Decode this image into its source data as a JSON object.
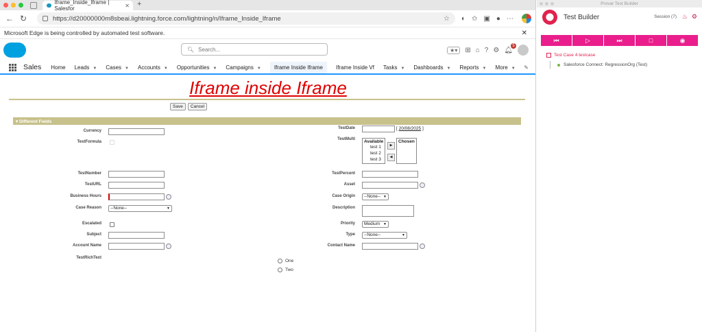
{
  "browser": {
    "tab_title": "Iframe_Inside_Iframe | Salesfor",
    "url": "https://d20000000m8sbeai.lightning.force.com/lightning/n/Iframe_Inside_Iframe",
    "infobar": "Microsoft Edge is being controlled by automated test software."
  },
  "salesforce": {
    "search_placeholder": "Search...",
    "notification_count": "5",
    "app_name": "Sales",
    "nav": [
      {
        "label": "Home",
        "chevron": false
      },
      {
        "label": "Leads",
        "chevron": true
      },
      {
        "label": "Cases",
        "chevron": true
      },
      {
        "label": "Accounts",
        "chevron": true
      },
      {
        "label": "Opportunities",
        "chevron": true
      },
      {
        "label": "Campaigns",
        "chevron": true
      },
      {
        "label": "Iframe Inside Iframe",
        "chevron": false,
        "active": true
      },
      {
        "label": "Iframe Inside Vf",
        "chevron": false
      },
      {
        "label": "Tasks",
        "chevron": true
      },
      {
        "label": "Dashboards",
        "chevron": true
      },
      {
        "label": "Reports",
        "chevron": true
      },
      {
        "label": "More",
        "chevron": true
      }
    ]
  },
  "form": {
    "page_title": "Iframe inside Iframe",
    "save_label": "Save",
    "cancel_label": "Cancel",
    "section_title": "▾ Different Fields",
    "labels": {
      "currency": "Currency",
      "test_formula": "TestFormula",
      "test_number": "TestNumber",
      "test_url": "TestURL",
      "business_hours": "Business Hours",
      "case_reason": "Case Reason",
      "escalated": "Escalated",
      "subject": "Subject",
      "account_name": "Account Name",
      "test_rich_text": "TestRichText",
      "test_date": "TestDate",
      "test_multi": "TestMulti",
      "test_percent": "TestPercent",
      "asset": "Asset",
      "case_origin": "Case Origin",
      "description": "Description",
      "priority": "Priority",
      "type": "Type",
      "contact_name": "Contact Name"
    },
    "values": {
      "test_date_link": "20/08/2025",
      "case_reason": "--None--",
      "case_origin": "--None--",
      "priority": "Medium",
      "type": "--None--"
    },
    "multi": {
      "available_header": "Available",
      "chosen_header": "Chosen",
      "options": [
        "test 1",
        "test 2",
        "test 3"
      ]
    },
    "radios": [
      "One",
      "Two"
    ]
  },
  "provar": {
    "window_title": "Provar Test Builder",
    "app_name": "Test Builder",
    "session": "Session (7)",
    "test_case": "Test Case 4 testcase",
    "step": "Salesforce Connect: RegressionOrg (Test)"
  },
  "colors": {
    "accent_pink": "#e91e8c",
    "salesforce_blue": "#1b96ff",
    "title_red": "#e00000",
    "section_olive": "#c7c18b"
  }
}
